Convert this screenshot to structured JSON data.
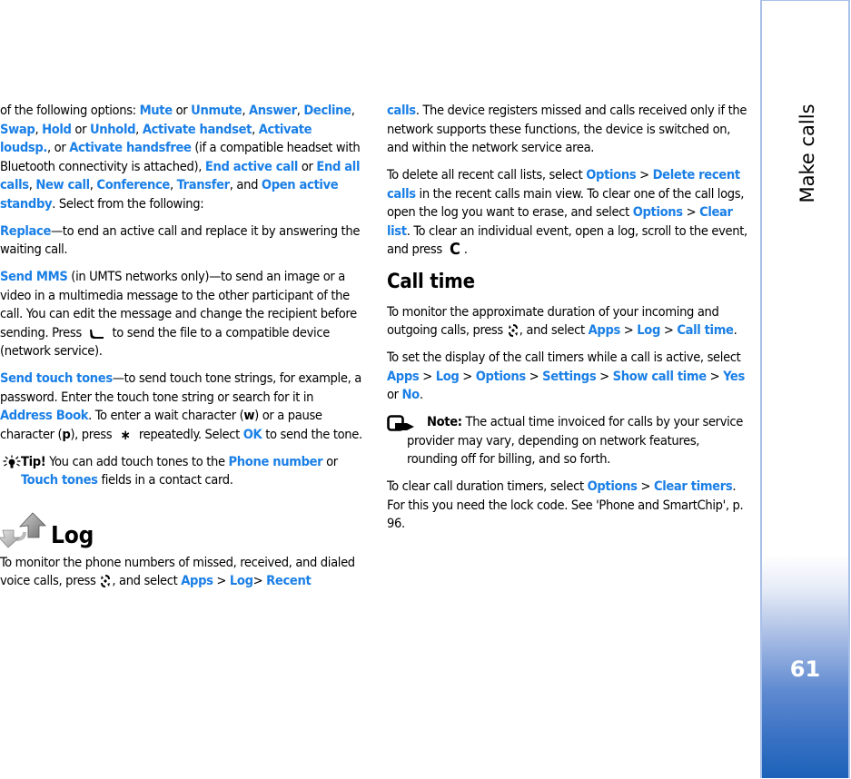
{
  "sidebar": {
    "section_title": "Make calls",
    "page_number": "61",
    "accent_color": "#1a62b8"
  },
  "colors": {
    "link": "#1a7fe6",
    "text": "#000000"
  },
  "left": {
    "p1": {
      "t1": "of the following options: ",
      "l_mute": "Mute",
      "t2": " or ",
      "l_unmute": "Unmute",
      "t3": ", ",
      "l_answer": "Answer",
      "t4": ", ",
      "l_decline": "Decline",
      "t5": ", ",
      "l_swap": "Swap",
      "t6": ", ",
      "l_hold": "Hold",
      "t7": " or ",
      "l_unhold": "Unhold",
      "t8": ", ",
      "l_act_handset": "Activate handset",
      "t9": ", ",
      "l_act_loudsp": "Activate loudsp.",
      "t10": ", or ",
      "l_act_handsfree": "Activate handsfree",
      "t11": " (if a compatible headset with Bluetooth connectivity is attached), ",
      "l_end_active": "End active call",
      "t12": " or ",
      "l_end_all": "End all calls",
      "t13": ", ",
      "l_new_call": "New call",
      "t14": ", ",
      "l_conference": "Conference",
      "t15": ", ",
      "l_transfer": "Transfer",
      "t16": ", and ",
      "l_open_standby": "Open active standby",
      "t17": ". Select from the following:"
    },
    "p2": {
      "l_replace": "Replace",
      "t1": "—to end an active call and replace it by answering the waiting call."
    },
    "p3": {
      "l_send_mms": "Send MMS",
      "t1": " (in UMTS networks only)—to send an image or a video in a multimedia message to the other participant of the call. You can edit the message and change the recipient before sending. Press ",
      "icon": "call-key-icon",
      "t2": " to send the file to a compatible device (network service)."
    },
    "p4": {
      "l_send_tones": "Send touch tones",
      "t1": "—to send touch tone strings, for example, a password. Enter the touch tone string or search for it in ",
      "l_address_book": "Address Book",
      "t2": ". To enter a wait character (",
      "b_w": "w",
      "t3": ") or a pause character (",
      "b_p": "p",
      "t4": "), press ",
      "icon": "star-key-icon",
      "t5": " repeatedly. Select ",
      "l_ok": "OK",
      "t6": " to send the tone."
    },
    "tip": {
      "icon": "lightbulb-icon",
      "label": "Tip!",
      "t1": " You can add touch tones to the ",
      "l_phone_number": "Phone number",
      "t2": " or ",
      "l_touch_tones": "Touch tones",
      "t3": " fields in a contact card."
    },
    "log_heading": {
      "icon": "log-arrows-icon",
      "title": "Log"
    },
    "p5": {
      "t1": "To monitor the phone numbers of missed, received, and dialed voice calls, press ",
      "icon": "menu-key-icon",
      "t2": ", and select ",
      "l_apps": "Apps",
      "t3": " > ",
      "l_log": "Log",
      "t4": "> ",
      "l_recent": "Recent"
    }
  },
  "right": {
    "p1": {
      "l_calls": "calls",
      "t1": ". The device registers missed and calls received only if the network supports these functions, the device is switched on, and within the network service area."
    },
    "p2": {
      "t1": "To delete all recent call lists, select ",
      "l_options": "Options",
      "t2": " > ",
      "l_delete_recent": "Delete recent calls",
      "t3": " in the recent calls main view. To clear one of the call logs, open the log you want to erase, and select ",
      "l_options2": "Options",
      "t4": " > ",
      "l_clear_list": "Clear list",
      "t5": ". To clear an individual event, open a log, scroll to the event, and press ",
      "icon": "clear-key-icon",
      "t6": "."
    },
    "call_time_heading": "Call time",
    "p3": {
      "t1": "To monitor the approximate duration of your incoming and outgoing calls, press ",
      "icon": "menu-key-icon",
      "t2": ", and select ",
      "l_apps": "Apps",
      "t3": " > ",
      "l_log": "Log",
      "t4": " > ",
      "l_call_time": "Call time",
      "t5": "."
    },
    "p4": {
      "t1": "To set the display of the call timers while a call is active, select ",
      "l_apps": "Apps",
      "t2": " > ",
      "l_log": "Log",
      "t3": " > ",
      "l_options": "Options",
      "t4": " > ",
      "l_settings": "Settings",
      "t5": " > ",
      "l_show_call_time": "Show call time",
      "t6": " > ",
      "l_yes": "Yes",
      "t7": " or ",
      "l_no": "No",
      "t8": "."
    },
    "note": {
      "icon": "note-hand-icon",
      "label": "Note:",
      "t1": " The actual time invoiced for calls by your service provider may vary, depending on network features, rounding off for billing, and so forth."
    },
    "p5": {
      "t1": "To clear call duration timers, select ",
      "l_options": "Options",
      "t2": " > ",
      "l_clear_timers": "Clear timers",
      "t3": ". For this you need the lock code. See 'Phone and SmartChip', p. 96."
    }
  }
}
